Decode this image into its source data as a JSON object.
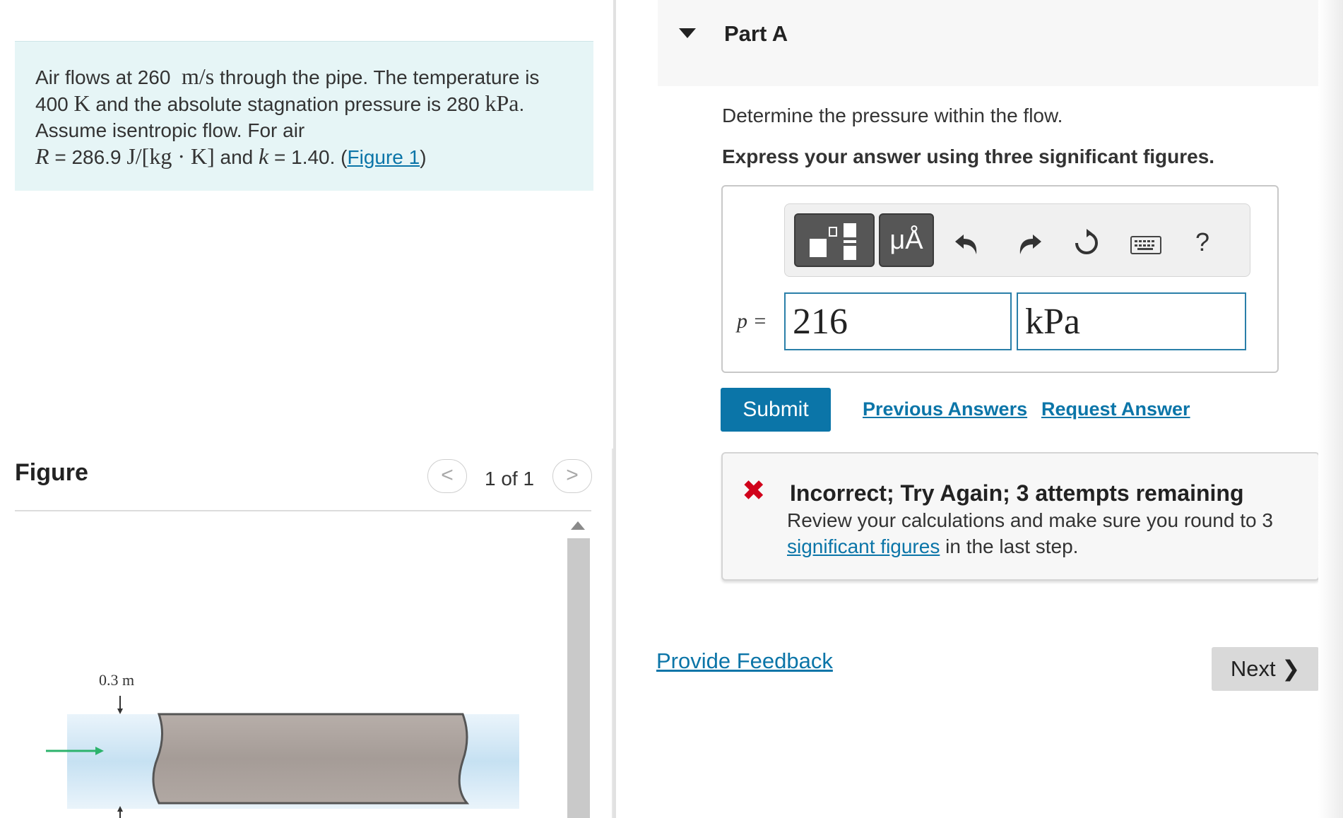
{
  "problem": {
    "t1": "Air flows at 260",
    "u1": "m/s",
    "t2": "through the pipe. The temperature is 400",
    "u2": "K",
    "t3": "and the absolute stagnation pressure is 280",
    "u3": "kPa",
    "t4": ". Assume isentropic flow. For air",
    "r_var": "R",
    "t5": "= 286.9",
    "u5": "J/[kg · K]",
    "t6": "and",
    "k_var": "k",
    "t7": "= 1.40. (",
    "figure_link": "Figure 1",
    "t8": ")"
  },
  "figure": {
    "title": "Figure",
    "pager_prev": "<",
    "pager_next": ">",
    "pager_count": "1 of 1",
    "diameter_label": "0.3 m"
  },
  "part": {
    "title": "Part A",
    "question": "Determine the pressure within the flow.",
    "instruction": "Express your answer using three significant figures."
  },
  "toolbar": {
    "units_label": "μÅ",
    "help_label": "?"
  },
  "answer": {
    "variable": "p =",
    "value": "216",
    "unit": "kPa"
  },
  "actions": {
    "submit": "Submit",
    "previous_answers": "Previous Answers",
    "request_answer": "Request Answer"
  },
  "feedback": {
    "icon": "✖",
    "title": "Incorrect; Try Again; 3 attempts remaining",
    "msg_before": "Review your calculations and make sure you round to 3 ",
    "msg_link": "significant figures",
    "msg_after": " in the last step."
  },
  "footer": {
    "provide_feedback": "Provide Feedback",
    "next": "Next",
    "next_icon": "❯"
  },
  "colors": {
    "accent": "#0b75a8",
    "problem_bg": "#e6f5f6",
    "error": "#d0021b"
  }
}
